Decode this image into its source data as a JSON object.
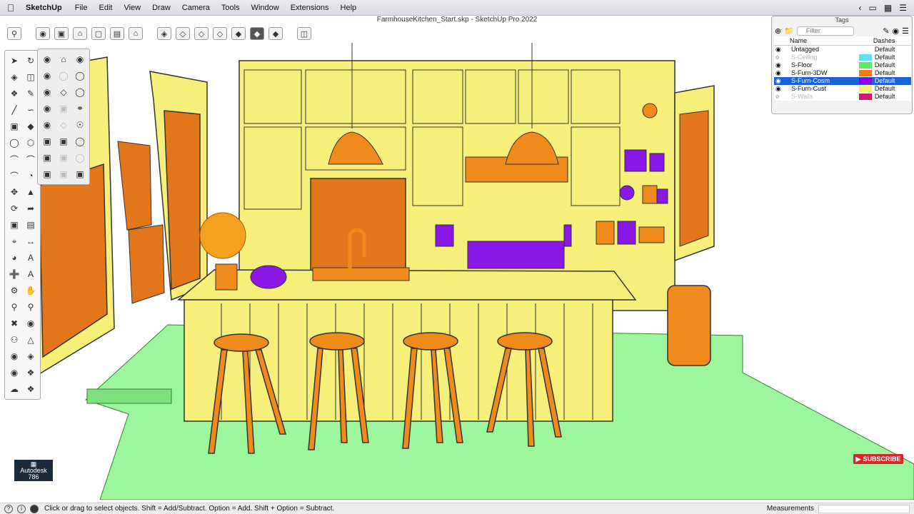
{
  "menubar": {
    "app_name": "SketchUp",
    "items": [
      "File",
      "Edit",
      "View",
      "Draw",
      "Camera",
      "Tools",
      "Window",
      "Extensions",
      "Help"
    ]
  },
  "window": {
    "title": "FarmhouseKitchen_Start.skp - SketchUp Pro 2022"
  },
  "tags_panel": {
    "title": "Tags",
    "filter_placeholder": "Filter",
    "col_name": "Name",
    "col_dashes": "Dashes",
    "rows": [
      {
        "name": "Untagged",
        "visible": true,
        "color": "",
        "dashes": "Default"
      },
      {
        "name": "S-Ceiling",
        "visible": false,
        "color": "#5fe2f0",
        "dashes": "Default"
      },
      {
        "name": "S-Floor",
        "visible": true,
        "color": "#5fe66a",
        "dashes": "Default"
      },
      {
        "name": "S-Furn-3DW",
        "visible": true,
        "color": "#f07a1a",
        "dashes": "Default"
      },
      {
        "name": "S-Furn-Cosm",
        "visible": true,
        "color": "#8b00e8",
        "dashes": "Default",
        "selected": true
      },
      {
        "name": "S-Furn-Cust",
        "visible": true,
        "color": "#f7f26a",
        "dashes": "Default"
      },
      {
        "name": "S-Walls",
        "visible": false,
        "color": "#e0146e",
        "dashes": "Default"
      }
    ]
  },
  "status": {
    "message": "Click or drag to select objects. Shift = Add/Subtract. Option = Add. Shift + Option = Subtract.",
    "measurements_label": "Measurements"
  },
  "overlay": {
    "autodesk_line1": "Autodesk",
    "autodesk_line2": "786",
    "subscribe": "SUBSCRIBE"
  },
  "colors": {
    "cabinet": "#f6f07a",
    "furniture": "#f08a1a",
    "cosmetic": "#8b17e6",
    "floor": "#9cf79c",
    "selection": "#1a62d6"
  }
}
